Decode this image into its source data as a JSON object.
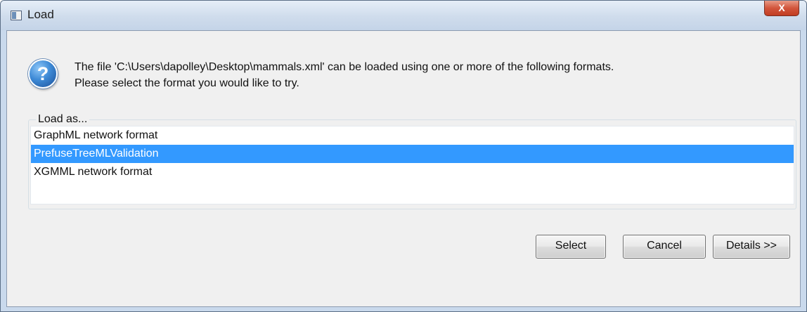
{
  "window": {
    "title": "Load",
    "close_label": "X"
  },
  "dialog": {
    "icon": "question-icon",
    "message_line1": "The file 'C:\\Users\\dapolley\\Desktop\\mammals.xml' can be loaded using one or more of the following formats.",
    "message_line2": "Please select the format you would like to try.",
    "group_label": "Load as...",
    "formats": [
      {
        "label": "GraphML network format",
        "selected": false
      },
      {
        "label": "PrefuseTreeMLValidation",
        "selected": true
      },
      {
        "label": "XGMML network format",
        "selected": false
      }
    ]
  },
  "buttons": {
    "select": "Select",
    "cancel": "Cancel",
    "details": "Details >>"
  },
  "colors": {
    "selection": "#3399ff",
    "close_button": "#c13d22"
  }
}
